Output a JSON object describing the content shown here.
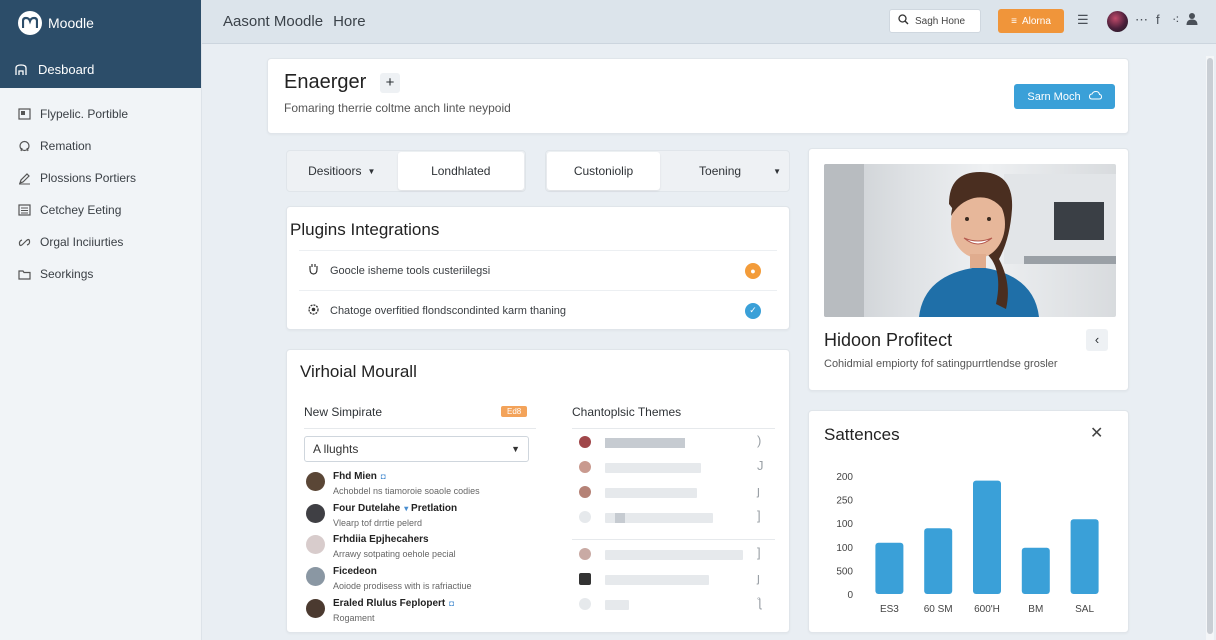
{
  "brand": {
    "name": "Moodle",
    "dashboard_label": "Desboard"
  },
  "sidebar": {
    "items": [
      {
        "label": "Flypelic. Portible",
        "icon": "portfolio-icon"
      },
      {
        "label": "Remation",
        "icon": "badge-icon"
      },
      {
        "label": "Plossions Portiers",
        "icon": "edit-icon"
      },
      {
        "label": "Cetchey Eeting",
        "icon": "calendar-icon"
      },
      {
        "label": "Orgal Inciiurties",
        "icon": "link-icon"
      },
      {
        "label": "Seorkings",
        "icon": "folder-icon"
      }
    ]
  },
  "topbar": {
    "title": "Aasont Moodle",
    "home": "Hore",
    "search_label": "Sagh Hone",
    "alert_label": "Alorna",
    "colors": {
      "accent": "#f0953a",
      "primary": "#3aa0d8",
      "sidebar_header": "#2c4d69"
    }
  },
  "hero": {
    "title": "Enaerger",
    "subtitle": "Fomaring therrie coltme anch linte neypoid",
    "cta_label": "Sarn Moch"
  },
  "tabs_left": [
    {
      "label": "Desitioors",
      "has_caret": true
    },
    {
      "label": "Londhlated",
      "has_caret": false
    }
  ],
  "tabs_right": [
    {
      "label": "Custoniolip",
      "has_caret": false
    },
    {
      "label": "Toening",
      "has_caret": true
    }
  ],
  "plugins": {
    "title": "Plugins Integrations",
    "rows": [
      {
        "label": "Goocle isheme tools custeriilegsi",
        "icon": "plug-icon",
        "badge_color": "#f39c3a"
      },
      {
        "label": "Chatoge overfitied flondscondinted karm thaning",
        "icon": "gear-icon",
        "badge_color": "#3aa0d8"
      }
    ]
  },
  "virtual": {
    "title": "Virhoial Mourall",
    "new_template": "New Simpirate",
    "tag": "Ed8",
    "select_value": "A llughts",
    "themes_title": "Chantoplsic Themes",
    "people": [
      {
        "name": "Fhd Mien",
        "desc": "Achobdel ns tiamoroie soaole codies",
        "av": "#5a4636"
      },
      {
        "name": "Four Dutelahe",
        "role": "Pretlation",
        "desc": "Vlearp tof drrtie pelerd",
        "av": "#3f3f44"
      },
      {
        "name": "Frhdiia Epjhecahers",
        "desc": "Arrawy sotpating oehole pecial",
        "av": "#c9b8b8"
      },
      {
        "name": "Ficedeon",
        "desc": "Aoiode prodisess with is rafriactiue",
        "av": "#8a97a3"
      },
      {
        "name": "Eraled Rlulus Feplopert",
        "desc": "Rogament",
        "av": "#4b3a30"
      }
    ]
  },
  "profile": {
    "name": "Hidoon Profitect",
    "desc": "Cohidmial empiorty fof satingpurrtlendse grosler"
  },
  "stats": {
    "title": "Sattences"
  },
  "chart_data": {
    "type": "bar",
    "title": "Sattences",
    "categories": [
      "ES3",
      "60 SM",
      "600'H",
      "BM",
      "SAL"
    ],
    "values": [
      113,
      145,
      250,
      102,
      165
    ],
    "yticks_labels": [
      "0",
      "500",
      "100",
      "100",
      "250",
      "200"
    ],
    "ylim": [
      0,
      300
    ],
    "color": "#3aa0d8",
    "grid": false
  }
}
